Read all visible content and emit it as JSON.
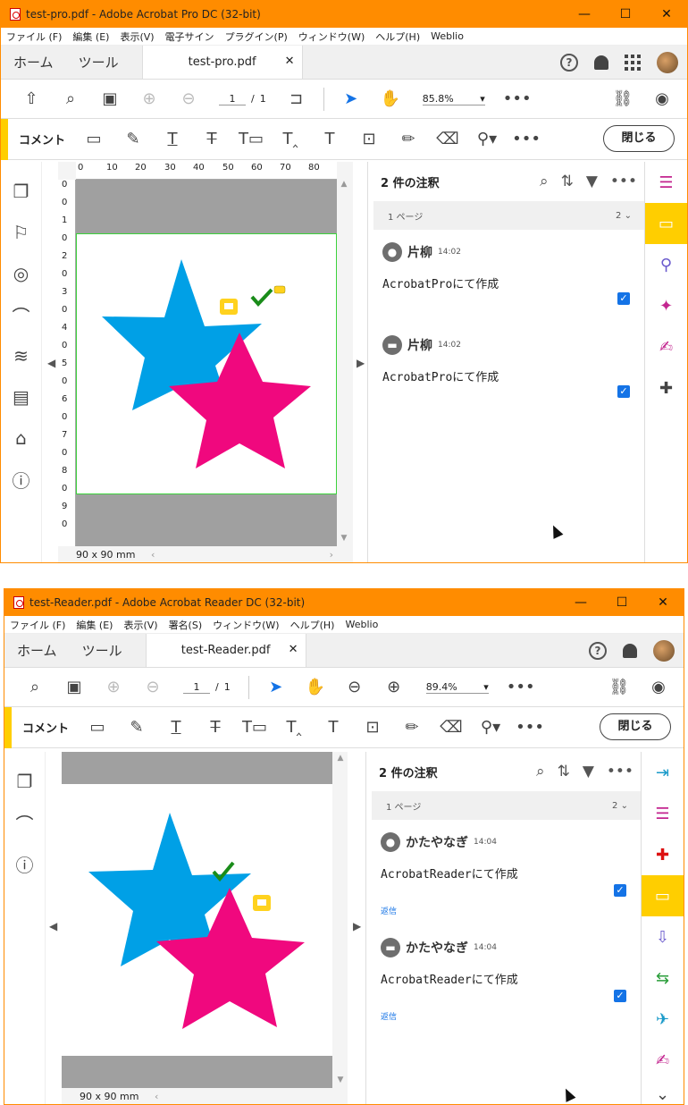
{
  "pro": {
    "title": "test-pro.pdf - Adobe Acrobat Pro DC (32-bit)",
    "win_controls": [
      "—",
      "☐",
      "✕"
    ],
    "menu": [
      "ファイル (F)",
      "編集 (E)",
      "表示(V)",
      "電子サイン",
      "プラグイン(P)",
      "ウィンドウ(W)",
      "ヘルプ(H)",
      "Weblio"
    ],
    "tabs": {
      "home": "ホーム",
      "tools": "ツール",
      "doc": "test-pro.pdf"
    },
    "page": {
      "current": "1",
      "sep": "/",
      "total": "1"
    },
    "zoom": "85.8%",
    "comment_label": "コメント",
    "close_label": "閉じる",
    "size_label": "90 x 90 mm",
    "ruler_h": [
      "0",
      "10",
      "20",
      "30",
      "40",
      "50",
      "60",
      "70",
      "80"
    ],
    "ruler_v": [
      "0",
      "0",
      "1",
      "0",
      "2",
      "0",
      "3",
      "0",
      "4",
      "0",
      "5",
      "0",
      "6",
      "0",
      "7",
      "0",
      "8",
      "0",
      "9",
      "0"
    ],
    "panel": {
      "count_title": "2 件の注釈",
      "page_group": "1 ページ",
      "page_group_count": "2",
      "comments": [
        {
          "author": "片柳",
          "time": "14:02",
          "body": "AcrobatProにて作成",
          "icon": "person-icon"
        },
        {
          "author": "片柳",
          "time": "14:02",
          "body": "AcrobatProにて作成",
          "icon": "note-icon"
        }
      ]
    }
  },
  "reader": {
    "title": "test-Reader.pdf - Adobe Acrobat Reader DC (32-bit)",
    "win_controls": [
      "—",
      "☐",
      "✕"
    ],
    "menu": [
      "ファイル (F)",
      "編集 (E)",
      "表示(V)",
      "署名(S)",
      "ウィンドウ(W)",
      "ヘルプ(H)",
      "Weblio"
    ],
    "tabs": {
      "home": "ホーム",
      "tools": "ツール",
      "doc": "test-Reader.pdf"
    },
    "page": {
      "current": "1",
      "sep": "/",
      "total": "1"
    },
    "zoom": "89.4%",
    "comment_label": "コメント",
    "close_label": "閉じる",
    "size_label": "90 x 90 mm",
    "panel": {
      "count_title": "2 件の注釈",
      "page_group": "1 ページ",
      "page_group_count": "2",
      "reply_label": "返信",
      "comments": [
        {
          "author": "かたやなぎ",
          "time": "14:04",
          "body": "AcrobatReaderにて作成",
          "icon": "person-icon"
        },
        {
          "author": "かたやなぎ",
          "time": "14:04",
          "body": "AcrobatReaderにて作成",
          "icon": "note-icon"
        }
      ]
    }
  },
  "colors": {
    "titlebar": "#ff8c00",
    "accent": "#ffce00",
    "blue_star": "#00a0e6",
    "pink_star": "#f0087e",
    "link": "#1473e6"
  }
}
